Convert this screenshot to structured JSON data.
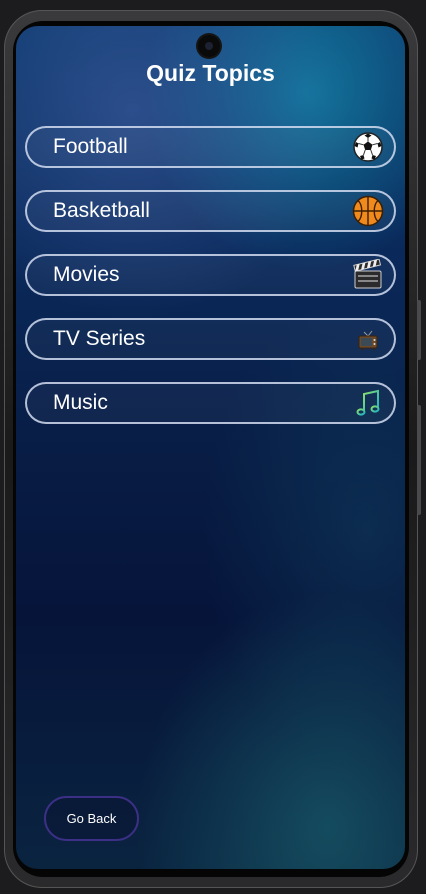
{
  "header": {
    "title": "Quiz Topics"
  },
  "topics": [
    {
      "label": "Football",
      "icon": "soccer-ball-icon"
    },
    {
      "label": "Basketball",
      "icon": "basketball-icon"
    },
    {
      "label": "Movies",
      "icon": "clapperboard-icon"
    },
    {
      "label": "TV Series",
      "icon": "television-icon"
    },
    {
      "label": "Music",
      "icon": "music-note-icon"
    }
  ],
  "footer": {
    "go_back_label": "Go Back"
  },
  "colors": {
    "background_top": "#0e3a6e",
    "background_bottom": "#06143a",
    "topic_border": "#d2dcf0",
    "go_back_border": "#3b2f86",
    "text": "#ffffff"
  }
}
